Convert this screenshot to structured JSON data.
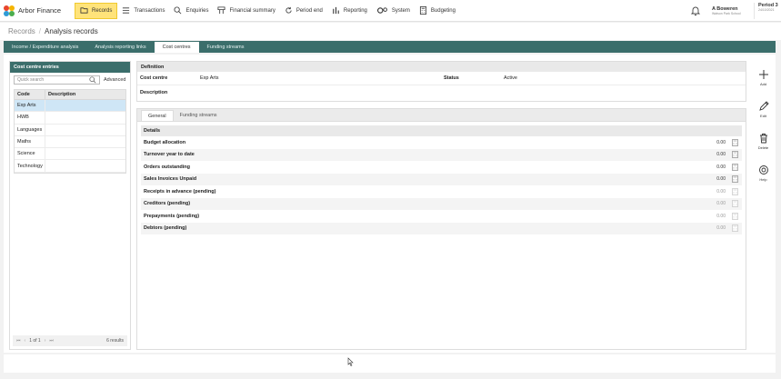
{
  "app": {
    "name": "Arbor Finance",
    "logo_icon": "arbor-logo-icon",
    "colors": {
      "teal": "#3b6e6b",
      "highlight": "#ffe37a",
      "selected_row": "#cfe6f6"
    }
  },
  "nav": {
    "items": [
      {
        "label": "Records",
        "icon": "folder-icon",
        "active": true
      },
      {
        "label": "Transactions",
        "icon": "list-icon",
        "active": false
      },
      {
        "label": "Enquiries",
        "icon": "search-icon",
        "active": false
      },
      {
        "label": "Financial summary",
        "icon": "summary-icon",
        "active": false
      },
      {
        "label": "Period end",
        "icon": "refresh-icon",
        "active": false
      },
      {
        "label": "Reporting",
        "icon": "bar-chart-icon",
        "active": false
      },
      {
        "label": "System",
        "icon": "gears-icon",
        "active": false
      },
      {
        "label": "Budgeting",
        "icon": "calculator-icon",
        "active": false
      }
    ]
  },
  "user": {
    "name": "A Boweren",
    "school": "Watson Park School",
    "period_label": "Period 3",
    "period_date": "24/10/2021"
  },
  "breadcrumb": {
    "root": "Records",
    "separator": "/",
    "current": "Analysis records"
  },
  "tabs": [
    {
      "label": "Income / Expenditure analysis",
      "active": false
    },
    {
      "label": "Analysis reporting links",
      "active": false
    },
    {
      "label": "Cost centres",
      "active": true
    },
    {
      "label": "Funding streams",
      "active": false
    }
  ],
  "left_panel": {
    "title": "Cost centre entries",
    "search_placeholder": "Quick search",
    "advanced_label": "Advanced",
    "columns": {
      "code": "Code",
      "description": "Description"
    },
    "rows": [
      {
        "code": "Exp Arts",
        "description": "",
        "selected": true
      },
      {
        "code": "HWB",
        "description": "",
        "selected": false
      },
      {
        "code": "Languages",
        "description": "",
        "selected": false
      },
      {
        "code": "Maths",
        "description": "",
        "selected": false
      },
      {
        "code": "Science",
        "description": "",
        "selected": false
      },
      {
        "code": "Technology",
        "description": "",
        "selected": false
      }
    ],
    "pager": {
      "first": "⏮",
      "prev": "‹",
      "page_text": "1 of 1",
      "next": "›",
      "last": "⏭",
      "results": "6 results"
    }
  },
  "definition": {
    "title": "Definition",
    "cost_centre_label": "Cost centre",
    "cost_centre_value": "Exp Arts",
    "status_label": "Status",
    "status_value": "Active",
    "description_label": "Description"
  },
  "sub_tabs": [
    {
      "label": "General",
      "active": true
    },
    {
      "label": "Funding streams",
      "active": false
    }
  ],
  "details": {
    "title": "Details",
    "rows": [
      {
        "label": "Budget allocation",
        "value": "0.00",
        "pending": false
      },
      {
        "label": "Turnover year to date",
        "value": "0.00",
        "pending": false
      },
      {
        "label": "Orders outstanding",
        "value": "0.00",
        "pending": false
      },
      {
        "label": "Sales Invoices Unpaid",
        "value": "0.00",
        "pending": false
      },
      {
        "label": "Receipts in advance (pending)",
        "value": "0.00",
        "pending": true
      },
      {
        "label": "Creditors (pending)",
        "value": "0.00",
        "pending": true
      },
      {
        "label": "Prepayments (pending)",
        "value": "0.00",
        "pending": true
      },
      {
        "label": "Debtors (pending)",
        "value": "0.00",
        "pending": true
      }
    ]
  },
  "actions": [
    {
      "label": "Add",
      "icon": "plus-icon"
    },
    {
      "label": "Edit",
      "icon": "pencil-icon"
    },
    {
      "label": "Delete",
      "icon": "trash-icon"
    },
    {
      "label": "Help",
      "icon": "help-icon"
    }
  ]
}
